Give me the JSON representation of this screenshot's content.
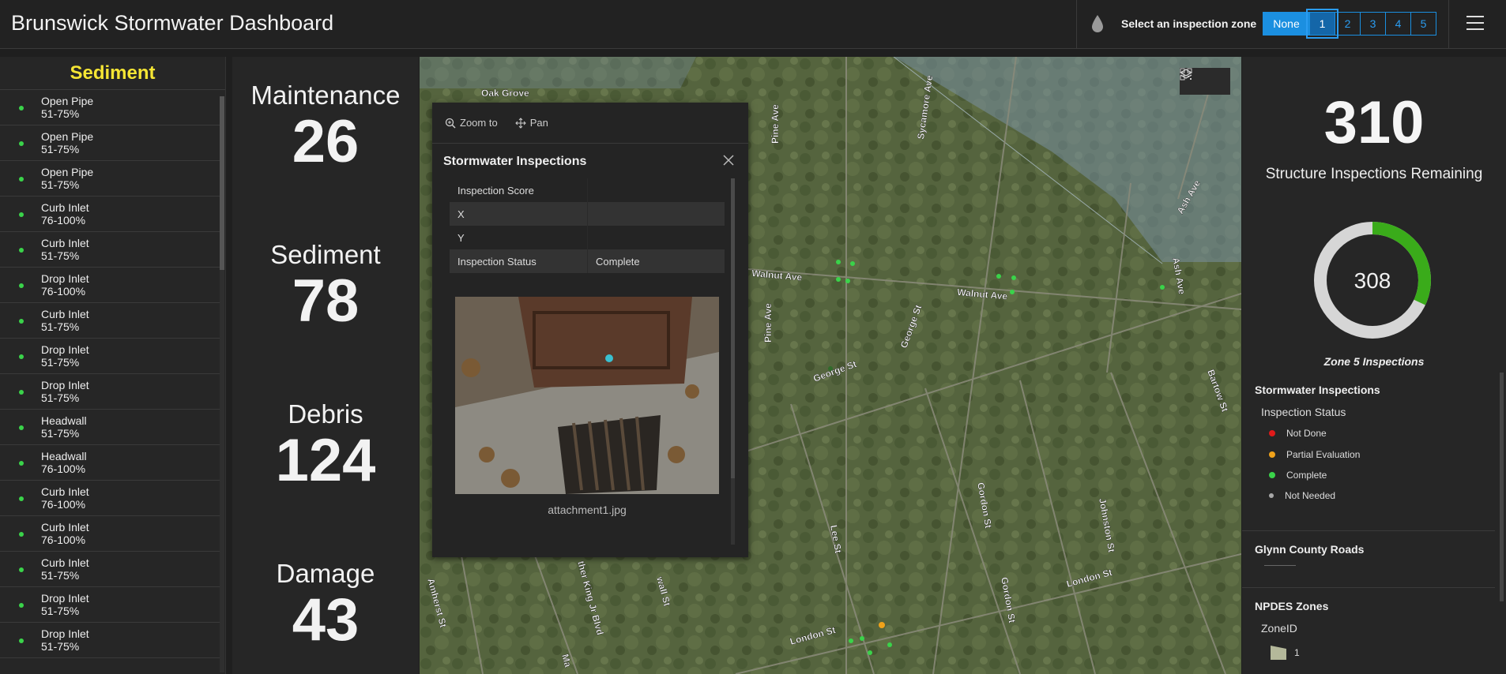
{
  "header": {
    "title": "Brunswick Stormwater Dashboard",
    "zone_label": "Select an inspection zone",
    "zones": [
      "None",
      "1",
      "2",
      "3",
      "4",
      "5"
    ]
  },
  "left_panel": {
    "title": "Sediment",
    "items": [
      {
        "type": "Open Pipe",
        "range": "51-75%"
      },
      {
        "type": "Open Pipe",
        "range": "51-75%"
      },
      {
        "type": "Open Pipe",
        "range": "51-75%"
      },
      {
        "type": "Curb Inlet",
        "range": "76-100%"
      },
      {
        "type": "Curb Inlet",
        "range": "51-75%"
      },
      {
        "type": "Drop Inlet",
        "range": "76-100%"
      },
      {
        "type": "Curb Inlet",
        "range": "51-75%"
      },
      {
        "type": "Drop Inlet",
        "range": "51-75%"
      },
      {
        "type": "Drop Inlet",
        "range": "51-75%"
      },
      {
        "type": "Headwall",
        "range": "51-75%"
      },
      {
        "type": "Headwall",
        "range": "76-100%"
      },
      {
        "type": "Curb Inlet",
        "range": "76-100%"
      },
      {
        "type": "Curb Inlet",
        "range": "76-100%"
      },
      {
        "type": "Curb Inlet",
        "range": "51-75%"
      },
      {
        "type": "Drop Inlet",
        "range": "51-75%"
      },
      {
        "type": "Drop Inlet",
        "range": "51-75%"
      }
    ]
  },
  "metrics": [
    {
      "label": "Maintenance",
      "value": "26"
    },
    {
      "label": "Sediment",
      "value": "78"
    },
    {
      "label": "Debris",
      "value": "124"
    },
    {
      "label": "Damage",
      "value": "43"
    }
  ],
  "map": {
    "labels": [
      "Oak Grove",
      "Pine Ave",
      "Sycamore Ave",
      "Ash Ave",
      "Walnut Ave",
      "Walnut Ave",
      "Ash Ave",
      "Pine Ave",
      "George St",
      "George St",
      "Bartow St",
      "Gordon St",
      "Gordon St",
      "Johnston St",
      "Lee St",
      "London St",
      "London St",
      "Amherst St",
      "ther King Jr Blvd",
      "wall St",
      "Ma"
    ]
  },
  "popup": {
    "zoom_label": "Zoom to",
    "pan_label": "Pan",
    "title": "Stormwater Inspections",
    "fields": [
      {
        "key": "Inspection Score",
        "value": ""
      },
      {
        "key": "X",
        "value": ""
      },
      {
        "key": "Y",
        "value": ""
      },
      {
        "key": "Inspection Status",
        "value": "Complete"
      }
    ],
    "attachment": "attachment1.jpg"
  },
  "right_panel": {
    "remaining_value": "310",
    "remaining_label": "Structure Inspections Remaining",
    "donut_value": "308",
    "donut_fraction_complete": 0.32,
    "donut_caption": "Zone 5 Inspections",
    "legend_title": "Stormwater Inspections",
    "legend_sub": "Inspection Status",
    "legend_items": [
      {
        "label": "Not Done",
        "color": "#e01a1a"
      },
      {
        "label": "Partial Evaluation",
        "color": "#f0a21a"
      },
      {
        "label": "Complete",
        "color": "#3ad34a"
      },
      {
        "label": "Not Needed",
        "color": "#a8a8a8"
      }
    ],
    "roads_title": "Glynn County Roads",
    "zones_title": "NPDES Zones",
    "zones_sub": "ZoneID",
    "zone_item": "1"
  },
  "colors": {
    "accent": "#1b8fe0",
    "sediment_title": "#f5e534",
    "donut_complete": "#3aab1a",
    "donut_remaining": "#d6d6d6"
  }
}
